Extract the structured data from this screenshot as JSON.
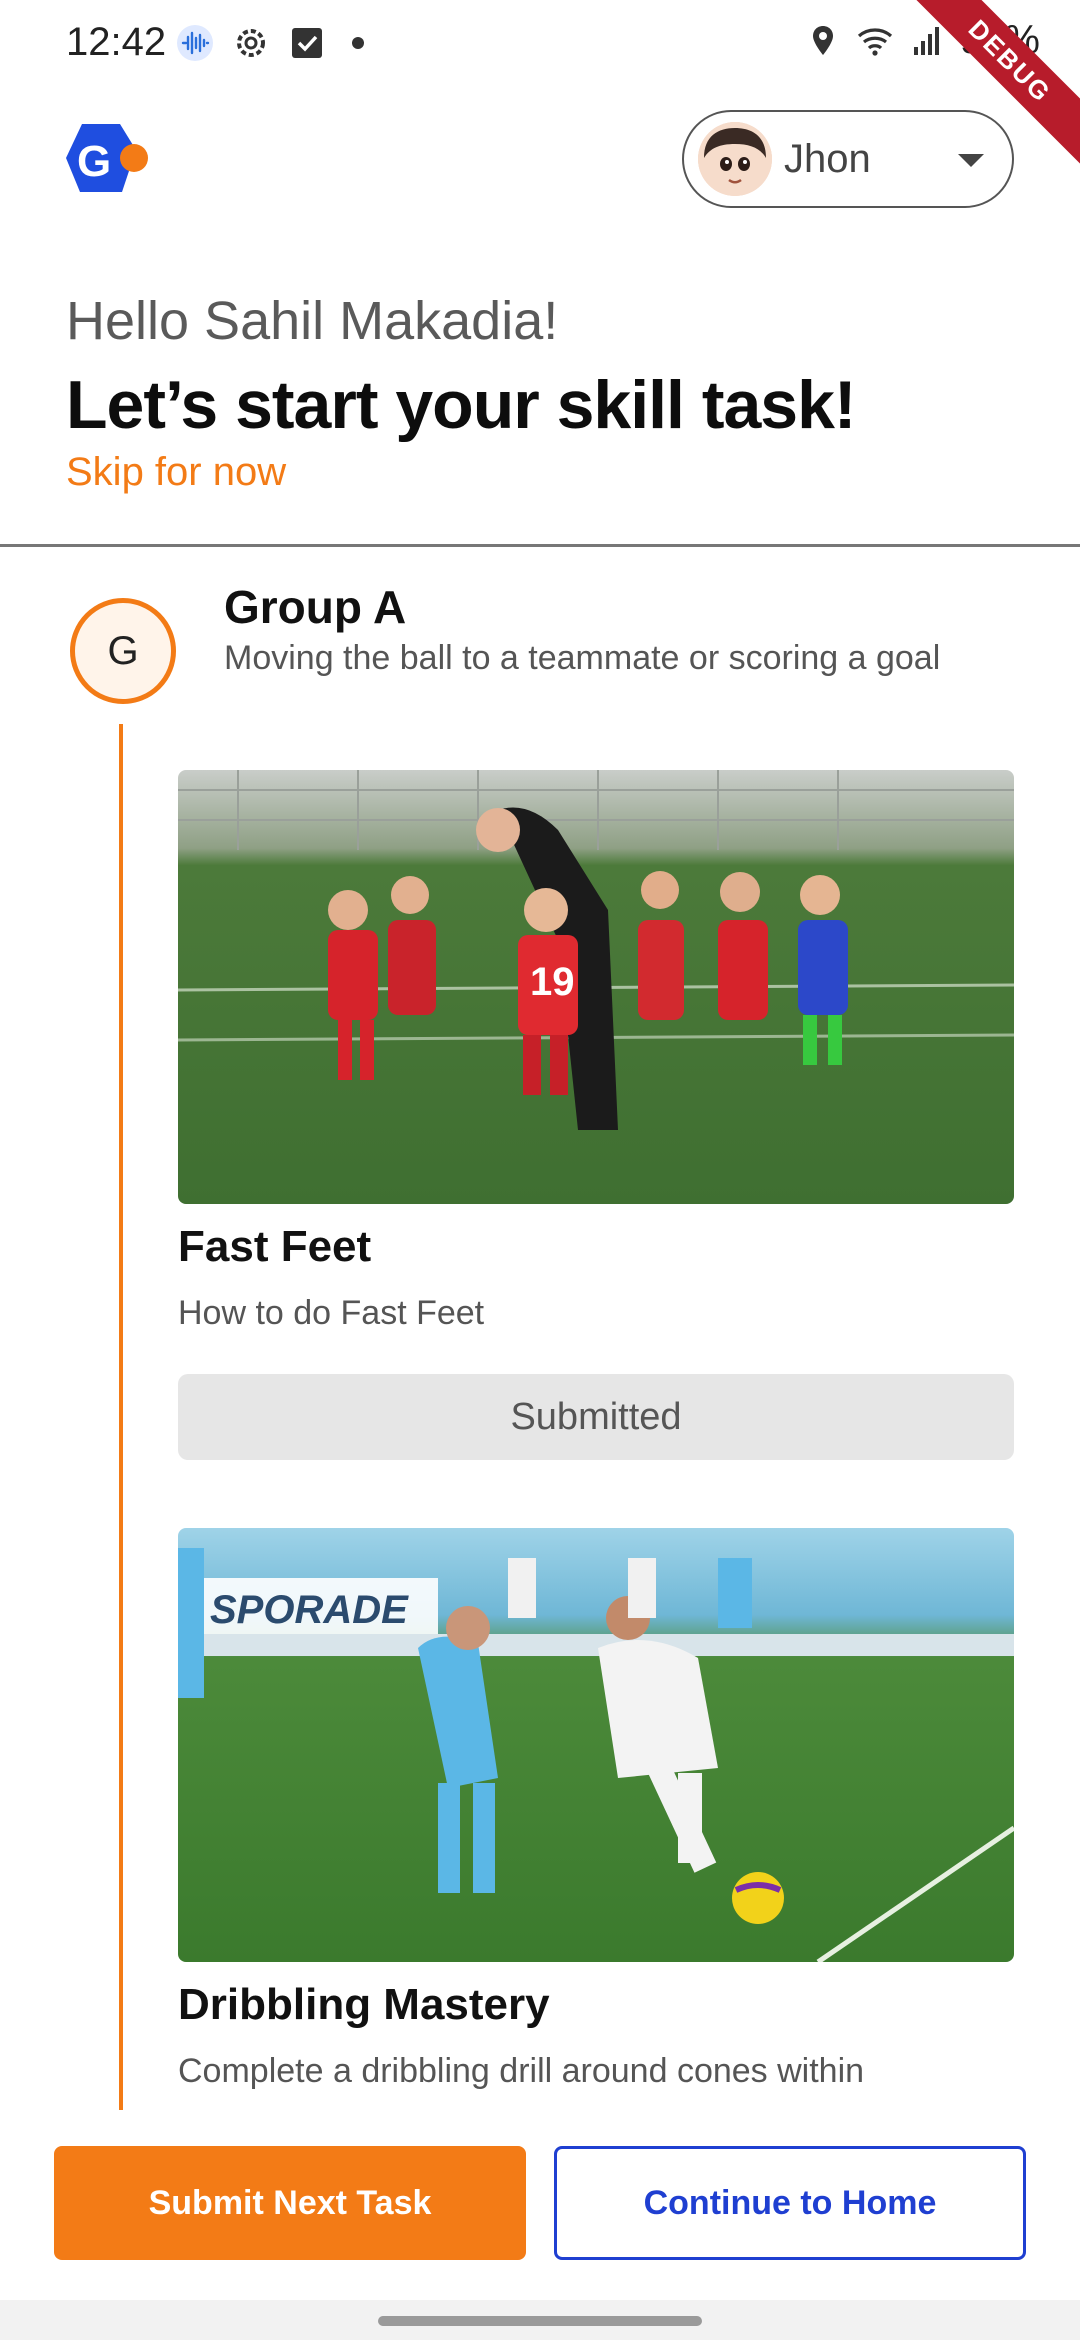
{
  "status_bar": {
    "time": "12:42",
    "battery": "99%",
    "debug_label": "DEBUG"
  },
  "header": {
    "logo_letter": "G",
    "user_name": "Jhon"
  },
  "intro": {
    "greeting": "Hello Sahil Makadia!",
    "headline": "Let’s start your skill task!",
    "skip_label": "Skip for now"
  },
  "group": {
    "badge": "G",
    "title": "Group A",
    "description": "Moving the ball to a teammate or scoring a goal"
  },
  "tasks": [
    {
      "title": "Fast Feet",
      "description": "How to do Fast Feet",
      "status": "Submitted",
      "jersey_number": "19"
    },
    {
      "title": "Dribbling Mastery",
      "description": "Complete a dribbling drill around cones within",
      "banner_text": "SPORADE"
    }
  ],
  "actions": {
    "primary": "Submit Next Task",
    "secondary": "Continue to Home"
  },
  "colors": {
    "accent": "#f37b16",
    "link_blue": "#1f3fd1",
    "debug_red": "#b71c2b"
  }
}
